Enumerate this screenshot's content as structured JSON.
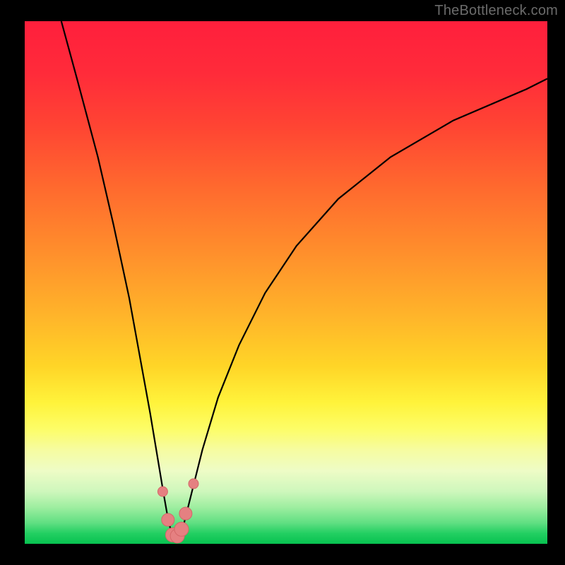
{
  "watermark": "TheBottleneck.com",
  "colors": {
    "frame": "#000000",
    "curve": "#000000",
    "marker_fill": "#e58081",
    "marker_stroke": "#d46768"
  },
  "chart_data": {
    "type": "line",
    "title": "",
    "xlabel": "",
    "ylabel": "",
    "xlim": [
      0,
      100
    ],
    "ylim": [
      0,
      100
    ],
    "grid": false,
    "legend": false,
    "series": [
      {
        "name": "bottleneck-curve",
        "x": [
          7,
          10,
          14,
          17,
          20,
          22,
          24,
          25.5,
          26.5,
          27.2,
          27.8,
          28.3,
          28.8,
          29.3,
          29.8,
          30.3,
          31,
          32,
          34,
          37,
          41,
          46,
          52,
          60,
          70,
          82,
          96,
          100
        ],
        "y": [
          100,
          89,
          74,
          61,
          47,
          36,
          25,
          16,
          10,
          6,
          3.2,
          1.8,
          1.2,
          1.2,
          1.8,
          3.2,
          6,
          10,
          18,
          28,
          38,
          48,
          57,
          66,
          74,
          81,
          87,
          89
        ]
      }
    ],
    "markers": {
      "name": "highlight-points",
      "x": [
        26.4,
        27.4,
        28.3,
        29.2,
        30.0,
        30.8,
        32.3
      ],
      "y": [
        10.0,
        4.6,
        1.7,
        1.5,
        2.8,
        5.8,
        11.5
      ],
      "r": [
        7,
        9,
        10,
        10,
        10,
        9,
        7
      ]
    }
  }
}
